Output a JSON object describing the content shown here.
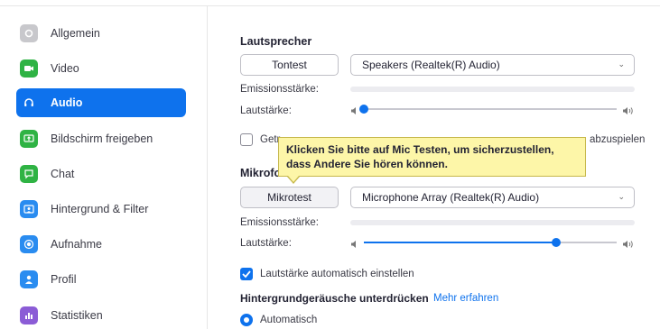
{
  "sidebar": {
    "items": [
      {
        "label": "Allgemein",
        "icon": "gear-icon",
        "color": "#c8c8cc",
        "active": false
      },
      {
        "label": "Video",
        "icon": "video-camera-icon",
        "color": "#2fb344",
        "active": false
      },
      {
        "label": "Audio",
        "icon": "headphones-icon",
        "color": "#0e72ed",
        "active": true
      },
      {
        "label": "Bildschirm freigeben",
        "icon": "share-screen-icon",
        "color": "#2fb344",
        "active": false
      },
      {
        "label": "Chat",
        "icon": "chat-bubble-icon",
        "color": "#2fb344",
        "active": false
      },
      {
        "label": "Hintergrund & Filter",
        "icon": "background-icon",
        "color": "#2a8cf0",
        "active": false
      },
      {
        "label": "Aufnahme",
        "icon": "record-icon",
        "color": "#2a8cf0",
        "active": false
      },
      {
        "label": "Profil",
        "icon": "person-icon",
        "color": "#2a8cf0",
        "active": false
      },
      {
        "label": "Statistiken",
        "icon": "bar-chart-icon",
        "color": "#8b5cd6",
        "active": false
      }
    ]
  },
  "speaker": {
    "title": "Lautsprecher",
    "test_button": "Tontest",
    "device": "Speakers (Realtek(R) Audio)",
    "output_level_label": "Emissionsstärke:",
    "volume_label": "Lautstärke:",
    "volume": 0.0
  },
  "separate_device": {
    "label_visible": "Getr",
    "label_tail": "abzuspielen",
    "checked": false
  },
  "tooltip": {
    "text": "Klicken Sie bitte auf Mic Testen, um sicherzustellen, dass Andere Sie hören können."
  },
  "microphone": {
    "title": "Mikrofo",
    "test_button": "Mikrotest",
    "device": "Microphone Array (Realtek(R) Audio)",
    "input_level_label": "Emissionsstärke:",
    "volume_label": "Lautstärke:",
    "volume": 0.76
  },
  "auto_volume": {
    "label": "Lautstärke automatisch einstellen",
    "checked": true
  },
  "noise": {
    "title": "Hintergrundgeräusche unterdrücken",
    "link": "Mehr erfahren",
    "option": "Automatisch"
  },
  "colors": {
    "accent": "#0e72ed",
    "tooltip_bg": "#fdf6a8"
  }
}
